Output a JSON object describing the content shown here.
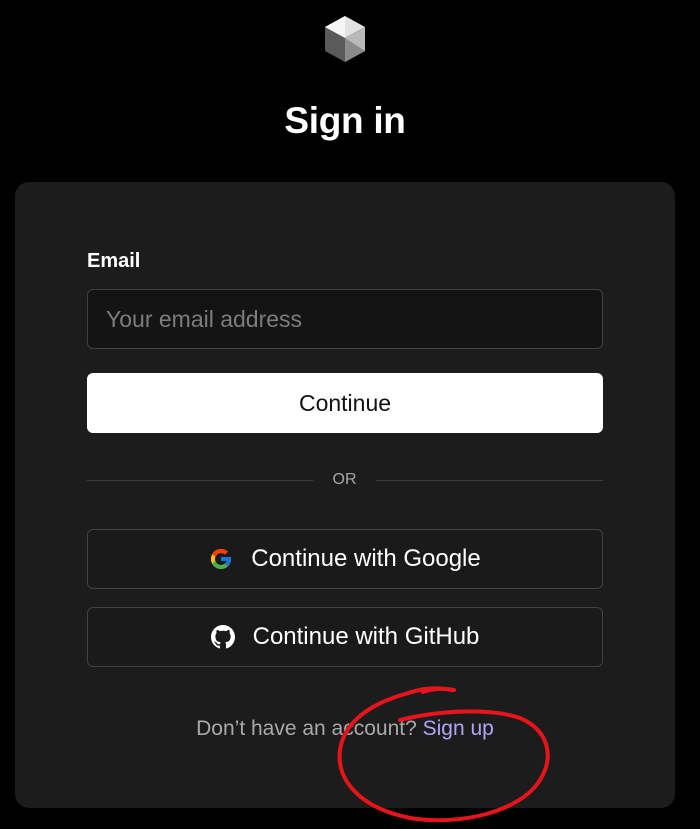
{
  "logo": {
    "icon": "cube-logo-icon"
  },
  "title": "Sign in",
  "form": {
    "email_label": "Email",
    "email_placeholder": "Your email address",
    "email_value": "",
    "continue_label": "Continue"
  },
  "divider": {
    "label": "OR"
  },
  "oauth": {
    "google": {
      "label": "Continue with Google",
      "icon": "google-icon"
    },
    "github": {
      "label": "Continue with GitHub",
      "icon": "github-icon"
    }
  },
  "signup": {
    "prompt": "Don’t have an account?",
    "link_label": "Sign up"
  },
  "annotation": {
    "color": "#e8141c",
    "shape": "hand-drawn circle"
  },
  "colors": {
    "background": "#000000",
    "card": "#1c1c1c",
    "link": "#b3a5f5"
  }
}
